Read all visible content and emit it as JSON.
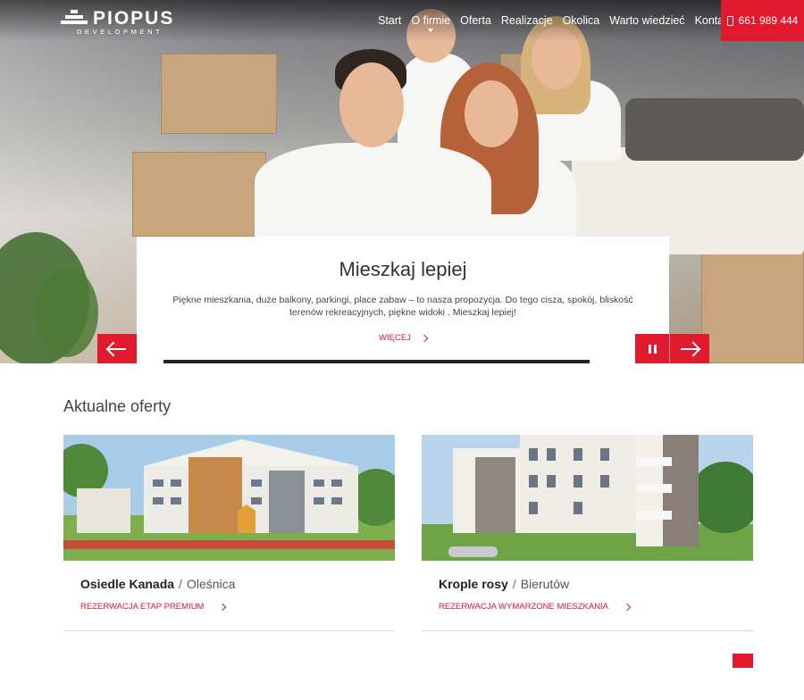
{
  "brand": {
    "name": "PIOPUS",
    "subtitle": "DEVELOPMENT"
  },
  "nav": {
    "items": [
      {
        "label": "Start"
      },
      {
        "label": "O firmie"
      },
      {
        "label": "Oferta"
      },
      {
        "label": "Realizacje"
      },
      {
        "label": "Okolica"
      },
      {
        "label": "Warto wiedzieć"
      },
      {
        "label": "Kontakt"
      }
    ],
    "phone": "661 989 444"
  },
  "slider": {
    "title": "Mieszkaj lepiej",
    "text": "Piękne mieszkania, duże balkony, parkingi, place zabaw – to nasza propozycja. Do tego cisza, spokój, bliskość terenów rekreacyjnych, piękne widoki . Mieszkaj lepiej!",
    "more_label": "WIĘCEJ"
  },
  "offers": {
    "title": "Aktualne oferty",
    "items": [
      {
        "name": "Osiedle Kanada",
        "city": "Oleśnica",
        "link": "REZERWACJA ETAP PREMIUM"
      },
      {
        "name": "Krople rosy",
        "city": "Bierutów",
        "link": "REZERWACJA WYMARZONE MIESZKANIA"
      }
    ]
  },
  "colors": {
    "accent": "#e0192c",
    "dark": "#222530"
  }
}
